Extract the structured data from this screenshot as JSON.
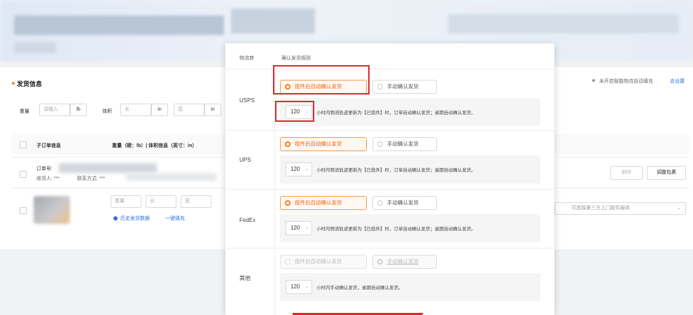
{
  "section": {
    "title": "发货信息",
    "notice": "未开启智能物流自动填充",
    "notice_link": "去设置"
  },
  "weight_bar": {
    "weight_label": "重量",
    "weight_placeholder": "请输入",
    "weight_unit": "lb",
    "volume_label": "体积",
    "length_placeholder": "长",
    "length_unit": "in",
    "width_placeholder": "宽",
    "width_unit": "in"
  },
  "table": {
    "col_suborder": "子订单信息",
    "col_weight": "重量（磅：lb）| 体积信息（英寸：in）"
  },
  "order": {
    "order_no_label": "订单号:",
    "receiver_label": "收货人: ***",
    "contact_label": "联系方式: ***",
    "delete_label": "删除",
    "split_label": "调整包裹"
  },
  "item": {
    "weight_ph": "重量",
    "len_ph": "长",
    "wid_ph": "宽",
    "history_label": "历史发货数据",
    "fill_label": "一键填充",
    "pickup_placeholder": "可选择第三方上门取件服务"
  },
  "panel": {
    "col_carrier": "物流商",
    "col_rule": "确认发货规则",
    "carriers": [
      {
        "name": "USPS",
        "opt_auto": "揽件后自动确认发货",
        "opt_manual": "手动确认发货",
        "selected": "auto",
        "hours": "120",
        "rule": "小时内物流轨迹更新为【已揽件】时，订单自动确认发货；逾期自动确认发货。"
      },
      {
        "name": "UPS",
        "opt_auto": "揽件后自动确认发货",
        "opt_manual": "手动确认发货",
        "selected": "auto",
        "hours": "120",
        "rule": "小时内物流轨迹更新为【已揽件】时，订单自动确认发货；逾期自动确认发货。"
      },
      {
        "name": "FedEx",
        "opt_auto": "揽件后自动确认发货",
        "opt_manual": "手动确认发货",
        "selected": "auto",
        "hours": "120",
        "rule": "小时内物流轨迹更新为【已揽件】时，订单自动确认发货；逾期自动确认发货。"
      },
      {
        "name": "其他",
        "opt_auto": "揽件后自动确认发货",
        "opt_manual": "手动确认发货",
        "selected": "manual-disabled",
        "hours": "120",
        "rule": "小时内手动确认发货，逾期自动确认发货。"
      }
    ]
  },
  "colors": {
    "accent": "#f57c20",
    "highlight_red": "#e0262d",
    "link_blue": "#2f6fe0"
  }
}
